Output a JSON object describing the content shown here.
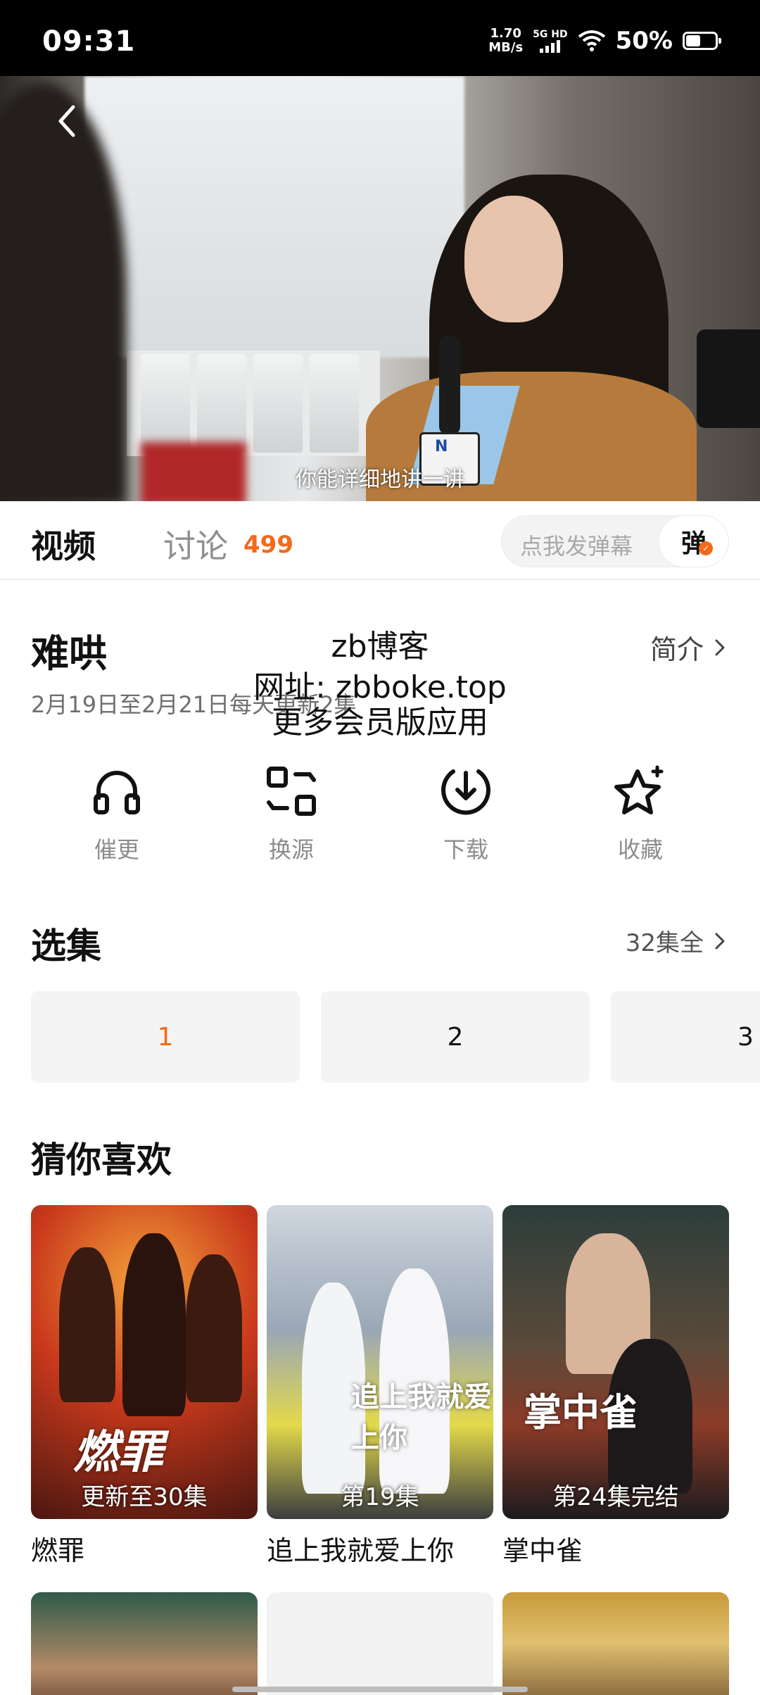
{
  "status_bar": {
    "time": "09:31",
    "net_speed_value": "1.70",
    "net_speed_unit": "MB/s",
    "net_type_top": "5G HD",
    "battery_percent": "50%",
    "battery_level": 0.5
  },
  "player": {
    "subtitle": "你能详细地讲一讲"
  },
  "tabs": {
    "video_label": "视频",
    "discuss_label": "讨论",
    "discuss_count": "499",
    "danmaku_placeholder": "点我发弹幕",
    "danmaku_button": "弹"
  },
  "show": {
    "title": "难哄",
    "update_info": "2月19日至2月21日每天更新2集",
    "intro_label": "简介"
  },
  "watermark": {
    "line1": "zb博客",
    "line2": "网址: zbboke.top",
    "line3": "更多会员版应用"
  },
  "actions": [
    {
      "label": "催更",
      "icon": "headphones-icon"
    },
    {
      "label": "换源",
      "icon": "switch-source-icon"
    },
    {
      "label": "下载",
      "icon": "download-icon"
    },
    {
      "label": "收藏",
      "icon": "star-icon"
    }
  ],
  "episodes": {
    "title": "选集",
    "total_label": "32集全",
    "items": [
      "1",
      "2",
      "3"
    ],
    "selected": "1"
  },
  "recommend": {
    "title": "猜你喜欢",
    "items": [
      {
        "name": "燃罪",
        "badge": "更新至30集"
      },
      {
        "name": "追上我就爱上你",
        "badge": "第19集"
      },
      {
        "name": "掌中雀",
        "badge": "第24集完结"
      }
    ]
  },
  "colors": {
    "accent": "#f26a1b",
    "status_bar_bg": "#000000",
    "episode_bg": "#f4f4f4"
  }
}
